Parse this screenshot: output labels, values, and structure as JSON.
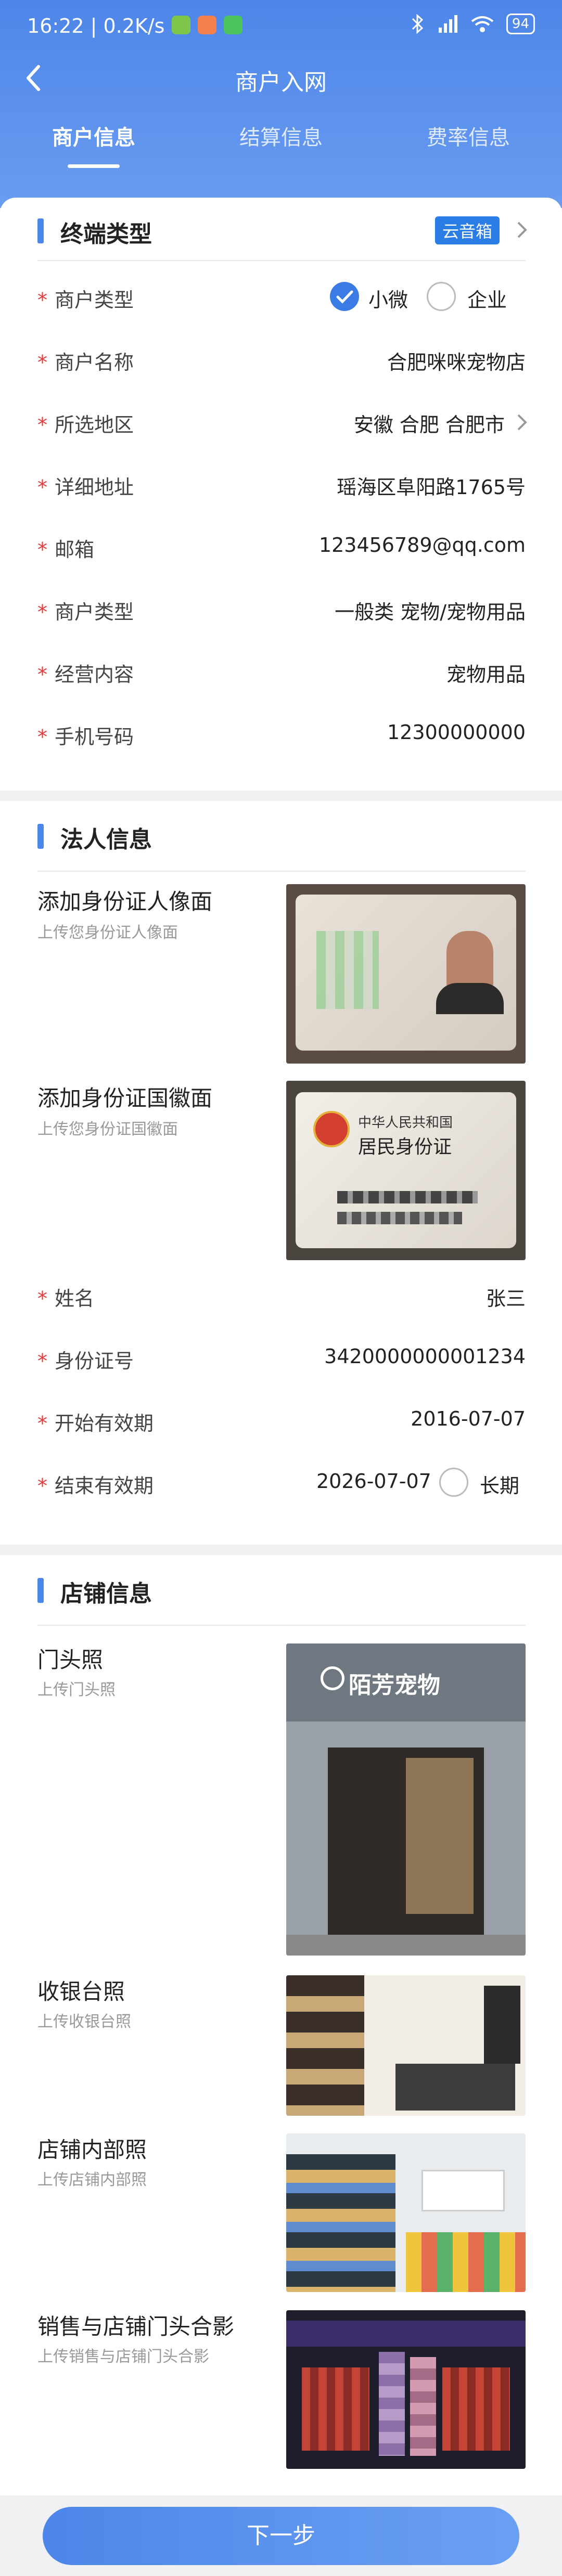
{
  "statusbar": {
    "time": "16:22 | 0.2K/s",
    "battery": "94"
  },
  "header": {
    "title": "商户入网"
  },
  "tabs": [
    "商户信息",
    "结算信息",
    "费率信息"
  ],
  "terminal": {
    "section_title": "终端类型",
    "badge": "云音箱",
    "fields": [
      {
        "label": "商户类型",
        "options": [
          "小微",
          "企业"
        ],
        "selected": "小微"
      },
      {
        "label": "商户名称",
        "value": "合肥咪咪宠物店"
      },
      {
        "label": "所选地区",
        "value": "安徽 合肥 合肥市"
      },
      {
        "label": "详细地址",
        "value": "瑶海区阜阳路1765号"
      },
      {
        "label": "邮箱",
        "value": "123456789@qq.com"
      },
      {
        "label": "商户类型",
        "value": "一般类 宠物/宠物用品"
      },
      {
        "label": "经营内容",
        "value": "宠物用品"
      },
      {
        "label": "手机号码",
        "value": "12300000000"
      }
    ]
  },
  "legal": {
    "section_title": "法人信息",
    "id_front": {
      "title": "添加身份证人像面",
      "sub": "上传您身份证人像面"
    },
    "id_back": {
      "title": "添加身份证国徽面",
      "sub": "上传您身份证国徽面",
      "card_line1": "中华人民共和国",
      "card_line2": "居民身份证"
    },
    "fields": [
      {
        "label": "姓名",
        "value": "张三"
      },
      {
        "label": "身份证号",
        "value": "3420000000001234"
      },
      {
        "label": "开始有效期",
        "value": "2016-07-07"
      },
      {
        "label": "结束有效期",
        "value": "2026-07-07",
        "option": "长期"
      }
    ]
  },
  "store": {
    "section_title": "店铺信息",
    "uploads": [
      {
        "title": "门头照",
        "sub": "上传门头照",
        "sign": "陌芳宠物"
      },
      {
        "title": "收银台照",
        "sub": "上传收银台照"
      },
      {
        "title": "店铺内部照",
        "sub": "上传店铺内部照"
      },
      {
        "title": "销售与店铺门头合影",
        "sub": "上传销售与店铺门头合影"
      }
    ]
  },
  "footer": {
    "next_label": "下一步"
  },
  "colors": {
    "primary": "#4d86e9",
    "required": "#e03a3a",
    "badge": "#2b7de6"
  }
}
